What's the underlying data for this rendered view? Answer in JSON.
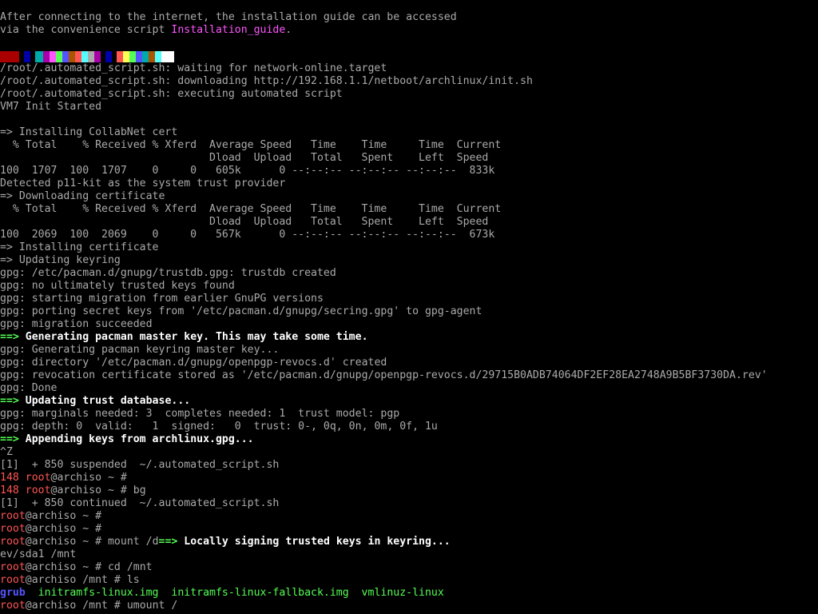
{
  "terminal": {
    "l01": "After connecting to the internet, the installation guide can be accessed",
    "l02a": "via the convenience script ",
    "l02b": "Installation_guide",
    "l02c": ".",
    "l04": "/root/.automated_script.sh: waiting for network-online.target",
    "l05": "/root/.automated_script.sh: downloading http://192.168.1.1/netboot/archlinux/init.sh",
    "l06": "/root/.automated_script.sh: executing automated script",
    "l07": "VM7 Init Started",
    "l09": "=> Installing CollabNet cert",
    "l10": "  % Total    % Received % Xferd  Average Speed   Time    Time     Time  Current",
    "l11": "                                 Dload  Upload   Total   Spent    Left  Speed",
    "l12": "100  1707  100  1707    0     0   605k      0 --:--:-- --:--:-- --:--:--  833k",
    "l13": "Detected p11-kit as the system trust provider",
    "l14": "=> Downloading certificate",
    "l15": "  % Total    % Received % Xferd  Average Speed   Time    Time     Time  Current",
    "l16": "                                 Dload  Upload   Total   Spent    Left  Speed",
    "l17": "100  2069  100  2069    0     0   567k      0 --:--:-- --:--:-- --:--:--  673k",
    "l18": "=> Installing certificate",
    "l19": "=> Updating keyring",
    "gpg": "gpg",
    "l20": ": /etc/pacman.d/gnupg/trustdb.gpg: trustdb created",
    "l21": ": no ultimately trusted keys found",
    "l22": ": starting migration from earlier GnuPG versions",
    "l23": ": porting secret keys from '/etc/pacman.d/gnupg/secring.gpg' to gpg-agent",
    "l24": ": migration succeeded",
    "arrow": "==>",
    "l25": " Generating pacman master key. This may take some time.",
    "l26": ": Generating pacman keyring master key...",
    "l27": ": directory '/etc/pacman.d/gnupg/openpgp-revocs.d' created",
    "l28": ": revocation certificate stored as '/etc/pacman.d/gnupg/openpgp-revocs.d/29715B0ADB74064DF2EF28EA2748A9B5BF3730DA.rev'",
    "l29": ": Done",
    "l30": " Updating trust database...",
    "l31": ": marginals needed: 3  completes needed: 1  trust model: pgp",
    "l32": ": depth: 0  valid:   1  signed:   0  trust: 0-, 0q, 0n, 0m, 0f, 1u",
    "l33": " Appending keys from archlinux.gpg...",
    "l34": "^Z",
    "l35": "[1]  + 850 suspended  ~/.automated_script.sh",
    "code148": "148 ",
    "root": "root",
    "at_host": "@archiso",
    "l36": " ~ #",
    "l37": " ~ # bg",
    "l38": "[1]  + 850 continued  ~/.automated_script.sh",
    "l39": " ~ #",
    "l40": " ~ #",
    "l41a": " ~ # mount /d",
    "l41b": " Locally signing trusted keys in keyring...",
    "l42": "ev/sda1 /mnt",
    "l43": " ~ # cd /mnt",
    "l44": " /mnt # ls",
    "ls_grub": "grub",
    "ls_rest": "  initramfs-linux.img  initramfs-linux-fallback.img  vmlinuz-linux",
    "l46": " /mnt # umount /"
  },
  "colors": {
    "background": "#000000",
    "text": "#aaaaaa",
    "prompt_user": "#ff5555",
    "arrow": "#55ff55",
    "link": "#ff55ff",
    "grub": "#5555ff"
  }
}
